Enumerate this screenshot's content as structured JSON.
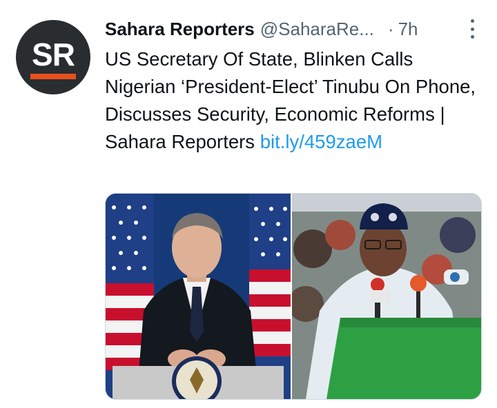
{
  "tweet": {
    "author": {
      "avatar_text": "SR",
      "display_name": "Sahara Reporters",
      "handle": "@SaharaRe...",
      "separator": "·",
      "time": "7h"
    },
    "text_main": "US Secretary Of State, Blinken Calls Nigerian ‘President-Elect’ Tinubu On Phone, Discusses Security, Economic Reforms | Sahara Reporters ",
    "link_text": "bit.ly/459zaeM",
    "media": [
      {
        "name": "blinken-photo",
        "icon": "photo"
      },
      {
        "name": "tinubu-photo",
        "icon": "photo"
      }
    ]
  },
  "colors": {
    "text": "#0f1419",
    "secondary": "#536471",
    "link": "#1d9bf0",
    "avatar_bg": "#2a2d30",
    "avatar_accent": "#e8501f"
  }
}
